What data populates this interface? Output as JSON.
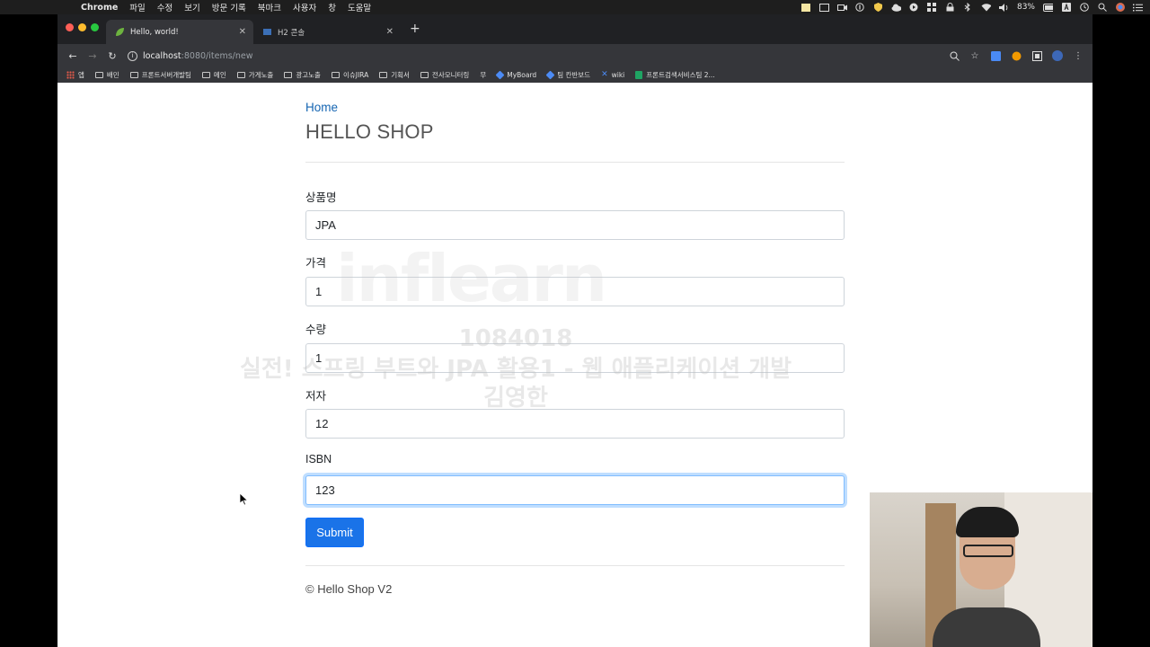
{
  "menubar": {
    "app": "Chrome",
    "items": [
      "파일",
      "수정",
      "보기",
      "방문 기록",
      "북마크",
      "사용자",
      "창",
      "도움말"
    ],
    "battery": "83%"
  },
  "tabs": [
    {
      "title": "Hello, world!",
      "active": true
    },
    {
      "title": "H2 콘솔",
      "active": false
    }
  ],
  "toolbar": {
    "url_host": "localhost",
    "url_path": ":8080/items/new"
  },
  "bookmarks": [
    "앱",
    "배민",
    "프론트서버개발팀",
    "메인",
    "가게노출",
    "광고노출",
    "이슈JIRA",
    "기획서",
    "전사모니터링",
    "무",
    "MyBoard",
    "팀 칸반보드",
    "wiki",
    "프론트검색서비스팀 2..."
  ],
  "page": {
    "home_link": "Home",
    "title": "HELLO SHOP",
    "fields": [
      {
        "label": "상품명",
        "value": "JPA"
      },
      {
        "label": "가격",
        "value": "1"
      },
      {
        "label": "수량",
        "value": "1"
      },
      {
        "label": "저자",
        "value": "12"
      },
      {
        "label": "ISBN",
        "value": "123"
      }
    ],
    "submit_label": "Submit",
    "footer": "© Hello Shop V2"
  },
  "watermark": {
    "logo": "inflearn",
    "id": "1084018",
    "course": "실전! 스프링 부트와 JPA 활용1 - 웹 애플리케이션 개발",
    "author": "김영한"
  },
  "colors": {
    "link": "#1565b2",
    "primary_button": "#1a73e8",
    "focus_ring": "#80bdff"
  }
}
